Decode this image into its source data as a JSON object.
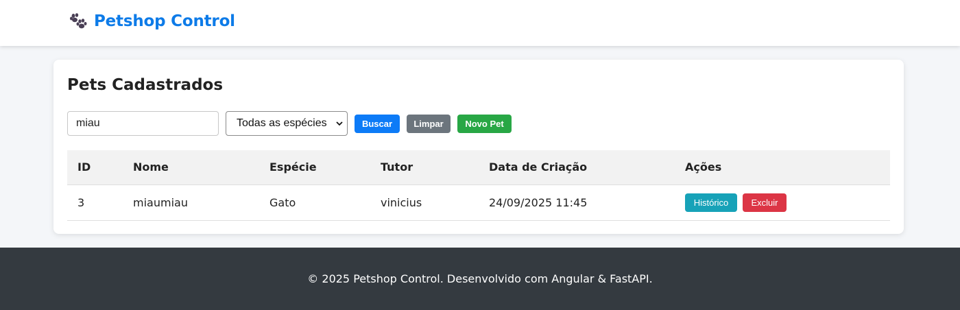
{
  "navbar": {
    "brand_title": "Petshop Control",
    "brand_icon": "paw-icon",
    "brand_color": "#0d7be8"
  },
  "card": {
    "title": "Pets Cadastrados",
    "search": {
      "value": "miau",
      "placeholder": ""
    },
    "species_select": {
      "selected": "Todas as espécies"
    },
    "buttons": {
      "buscar": "Buscar",
      "limpar": "Limpar",
      "novo": "Novo Pet"
    },
    "table": {
      "headers": {
        "id": "ID",
        "nome": "Nome",
        "especie": "Espécie",
        "tutor": "Tutor",
        "data": "Data de Criação",
        "acoes": "Ações"
      },
      "rows": [
        {
          "id": "3",
          "nome": "miaumiau",
          "especie": "Gato",
          "tutor": "vinicius",
          "data": "24/09/2025 11:45",
          "historico": "Histórico",
          "excluir": "Excluir"
        }
      ]
    }
  },
  "footer": {
    "text": "© 2025 Petshop Control. Desenvolvido com Angular & FastAPI."
  },
  "colors": {
    "primary": "#0d7bf7",
    "secondary": "#6c757d",
    "success": "#28a745",
    "info": "#17a2b8",
    "danger": "#dc3545",
    "footer_bg": "#343a40"
  }
}
